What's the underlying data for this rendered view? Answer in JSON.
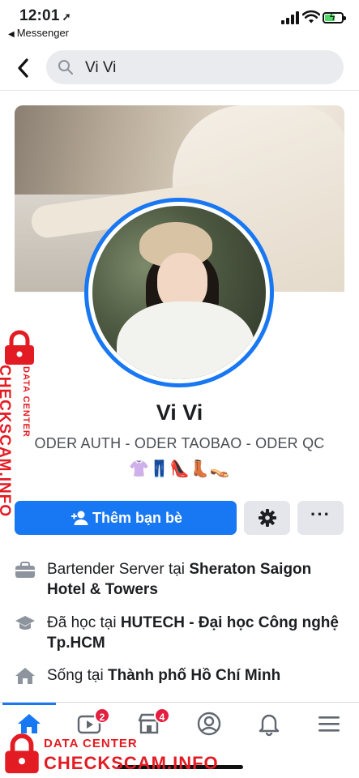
{
  "status": {
    "time": "12:01",
    "back_app": "Messenger"
  },
  "search": {
    "query": "Vi Vi"
  },
  "profile": {
    "name": "Vi Vi",
    "bio": "ODER AUTH - ODER TAOBAO - ODER QC",
    "emojis": "👚👖👠👢👡"
  },
  "actions": {
    "add_friend_label": "Thêm bạn bè"
  },
  "info": [
    {
      "icon": "briefcase-icon",
      "prefix": "Bartender Server tại ",
      "bold": "Sheraton Saigon Hotel & Towers"
    },
    {
      "icon": "graduation-cap-icon",
      "prefix": "Đã học tại ",
      "bold": "HUTECH - Đại học Công nghệ Tp.HCM"
    },
    {
      "icon": "house-icon",
      "prefix": "Sống tại ",
      "bold": "Thành phố Hồ Chí Minh"
    }
  ],
  "tabbar": {
    "items": [
      {
        "name": "home",
        "active": true
      },
      {
        "name": "watch",
        "badge": "2"
      },
      {
        "name": "marketplace",
        "badge": "4"
      },
      {
        "name": "profile"
      },
      {
        "name": "notifications"
      },
      {
        "name": "menu"
      }
    ]
  },
  "watermark": {
    "small": "DATA CENTER",
    "big": "CHECKSCAM.INFO"
  },
  "colors": {
    "accent": "#1877f2",
    "badge": "#e41e3f",
    "watermark": "#e31b23"
  }
}
